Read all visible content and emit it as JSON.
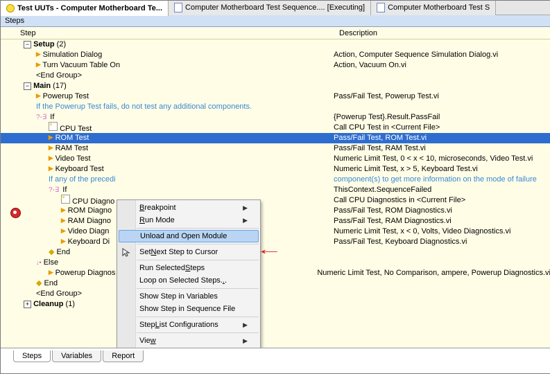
{
  "tabs": [
    {
      "label": "Test UUTs - Computer Motherboard Te...",
      "active": true
    },
    {
      "label": "Computer Motherboard Test Sequence.... [Executing]"
    },
    {
      "label": "Computer Motherboard Test S"
    }
  ],
  "pane_title": "Steps",
  "columns": {
    "step": "Step",
    "desc": "Description"
  },
  "rows": [
    {
      "indent": 1,
      "kind": "group",
      "icon": "minus",
      "label": "Setup",
      "count": "(2)"
    },
    {
      "indent": 2,
      "kind": "action",
      "label": "Simulation Dialog",
      "desc": "Action,  Computer Sequence Simulation Dialog.vi"
    },
    {
      "indent": 2,
      "kind": "action",
      "label": "Turn Vacuum Table On",
      "desc": "Action,  Vacuum On.vi"
    },
    {
      "indent": 2,
      "kind": "text",
      "label": "<End Group>"
    },
    {
      "indent": 1,
      "kind": "group",
      "icon": "minus",
      "label": "Main",
      "count": "(17)"
    },
    {
      "indent": 2,
      "kind": "action",
      "label": "Powerup Test",
      "desc": "Pass/Fail Test,  Powerup Test.vi"
    },
    {
      "indent": 2,
      "kind": "hint",
      "label": "If the Powerup Test fails, do not test any additional components."
    },
    {
      "indent": 2,
      "kind": "if",
      "label": "If",
      "desc": "{Powerup Test}.Result.PassFail"
    },
    {
      "indent": 3,
      "kind": "lv",
      "label": "CPU Test",
      "desc": "Call CPU Test in <Current File>"
    },
    {
      "indent": 3,
      "kind": "action",
      "label": "ROM Test",
      "desc": "Pass/Fail Test,  ROM Test.vi",
      "selected": true
    },
    {
      "indent": 3,
      "kind": "action",
      "label": "RAM Test",
      "desc": "Pass/Fail Test,  RAM Test.vi"
    },
    {
      "indent": 3,
      "kind": "action",
      "label": "Video Test",
      "desc": "Numeric Limit Test,  0 < x < 10, microseconds, Video Test.vi"
    },
    {
      "indent": 3,
      "kind": "action",
      "label": "Keyboard Test",
      "desc": "Numeric Limit Test,  x > 5, Keyboard Test.vi"
    },
    {
      "indent": 3,
      "kind": "hint",
      "label": "If any of the precedi",
      "desc": "component(s) to get more information on the mode of failure"
    },
    {
      "indent": 3,
      "kind": "if",
      "label": "If",
      "desc": "ThisContext.SequenceFailed"
    },
    {
      "indent": 4,
      "kind": "lv",
      "label": "CPU Diagno",
      "desc": "Call CPU Diagnostics in <Current File>"
    },
    {
      "indent": 4,
      "kind": "action",
      "label": "ROM Diagno",
      "desc": "Pass/Fail Test,  ROM Diagnostics.vi"
    },
    {
      "indent": 4,
      "kind": "action",
      "label": "RAM Diagno",
      "desc": "Pass/Fail Test,  RAM Diagnostics.vi"
    },
    {
      "indent": 4,
      "kind": "action",
      "label": "Video Diagn",
      "desc": "Numeric Limit Test,  x < 0, Volts, Video Diagnostics.vi"
    },
    {
      "indent": 4,
      "kind": "action",
      "label": "Keyboard Di",
      "desc": "Pass/Fail Test,  Keyboard Diagnostics.vi"
    },
    {
      "indent": 3,
      "kind": "end",
      "label": "End"
    },
    {
      "indent": 2,
      "kind": "else",
      "label": "Else"
    },
    {
      "indent": 3,
      "kind": "action",
      "label": "Powerup Diagnos",
      "desc": "Numeric Limit Test,  No Comparison, ampere, Powerup Diagnostics.vi"
    },
    {
      "indent": 2,
      "kind": "end",
      "label": "End"
    },
    {
      "indent": 2,
      "kind": "text",
      "label": "<End Group>"
    },
    {
      "indent": 1,
      "kind": "group",
      "icon": "plus",
      "label": "Cleanup",
      "count": "(1)"
    }
  ],
  "context_menu": [
    {
      "label": "Breakpoint",
      "submenu": true,
      "u": 0
    },
    {
      "label": "Run Mode",
      "submenu": true,
      "u": 0
    },
    {
      "sep": true
    },
    {
      "label": "Unload and Open Module",
      "highlight": true
    },
    {
      "sep": true
    },
    {
      "label": "Set Next Step to Cursor",
      "icon": "cursor",
      "u": 4
    },
    {
      "sep": true
    },
    {
      "label": "Run Selected Steps",
      "u": 13
    },
    {
      "label": "Loop on Selected Steps...",
      "u": 23
    },
    {
      "sep": true
    },
    {
      "label": "Show Step in Variables"
    },
    {
      "label": "Show Step in Sequence File"
    },
    {
      "sep": true
    },
    {
      "label": "Step List Configurations",
      "submenu": true,
      "u": 5
    },
    {
      "sep": true
    },
    {
      "label": "View",
      "submenu": true,
      "u": 3
    }
  ],
  "bottom_tabs": [
    "Steps",
    "Variables",
    "Report"
  ]
}
